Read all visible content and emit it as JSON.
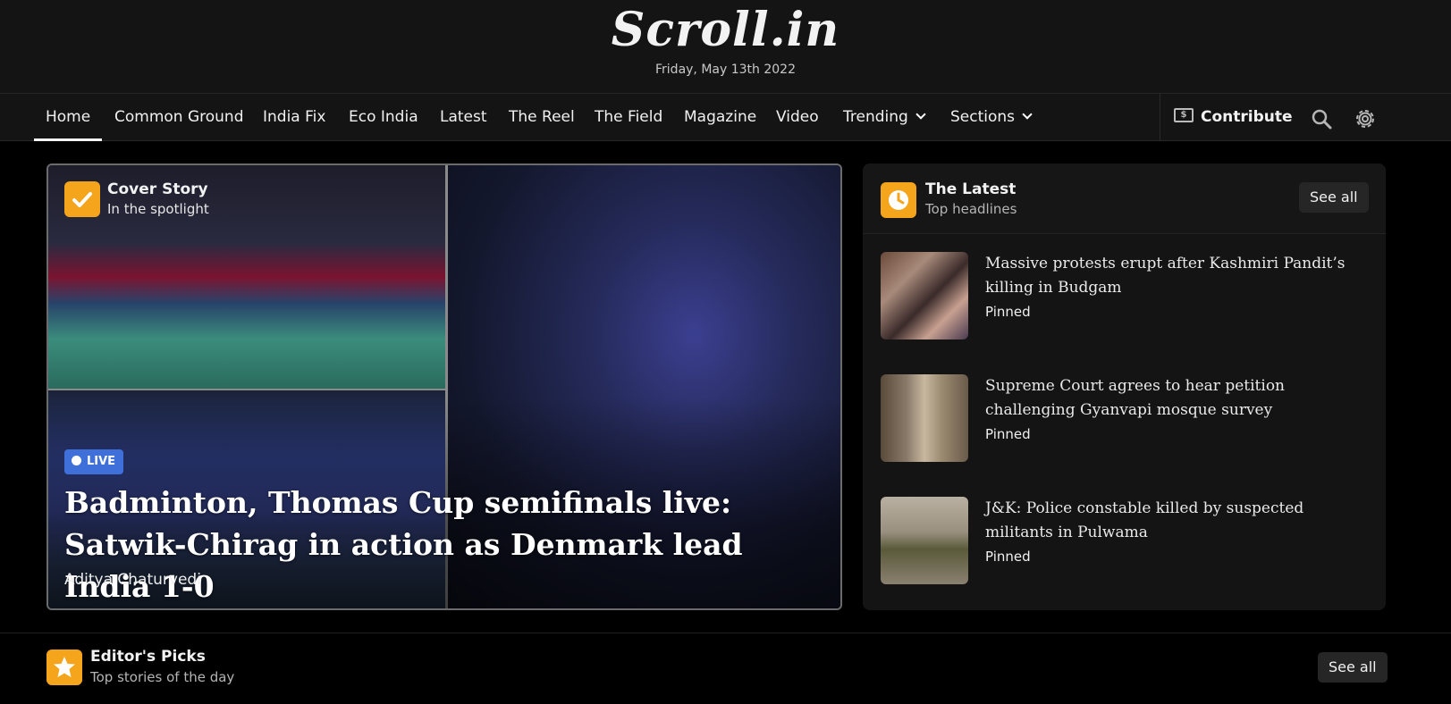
{
  "header": {
    "logo": "Scroll.in",
    "date": "Friday, May 13th 2022"
  },
  "nav": {
    "items": [
      {
        "label": "Home"
      },
      {
        "label": "Common Ground"
      },
      {
        "label": "India Fix"
      },
      {
        "label": "Eco India"
      },
      {
        "label": "Latest"
      },
      {
        "label": "The Reel"
      },
      {
        "label": "The Field"
      },
      {
        "label": "Magazine"
      },
      {
        "label": "Video"
      },
      {
        "label": "Trending"
      },
      {
        "label": "Sections"
      }
    ],
    "active": "Home",
    "contribute_label": "Contribute",
    "icons": [
      "money-icon",
      "search-icon",
      "gear-icon"
    ]
  },
  "cover_story": {
    "title": "Cover Story",
    "subtitle": "In the spotlight",
    "live_label": "LIVE",
    "headline": "Badminton, Thomas Cup semifinals live: Satwik-Chirag in action as Denmark lead India 1-0",
    "author": "Aditya Chaturvedi",
    "icon": "check-icon"
  },
  "latest": {
    "title": "The Latest",
    "subtitle": "Top headlines",
    "see_all": "See all",
    "icon": "clock-icon",
    "items": [
      {
        "title": "Massive protests erupt after Kashmiri Pandit’s killing in Budgam",
        "tag": "Pinned"
      },
      {
        "title": "Supreme Court agrees to hear petition challenging Gyanvapi mosque survey",
        "tag": "Pinned"
      },
      {
        "title": "J&K: Police constable killed by suspected militants in Pulwama",
        "tag": "Pinned"
      }
    ]
  },
  "editors_picks": {
    "title": "Editor's Picks",
    "subtitle": "Top stories of the day",
    "see_all": "See all",
    "icon": "star-icon"
  },
  "colors": {
    "accent": "#f5a51c",
    "live": "#3f6fd8",
    "background": "#000000",
    "header": "#141414"
  }
}
